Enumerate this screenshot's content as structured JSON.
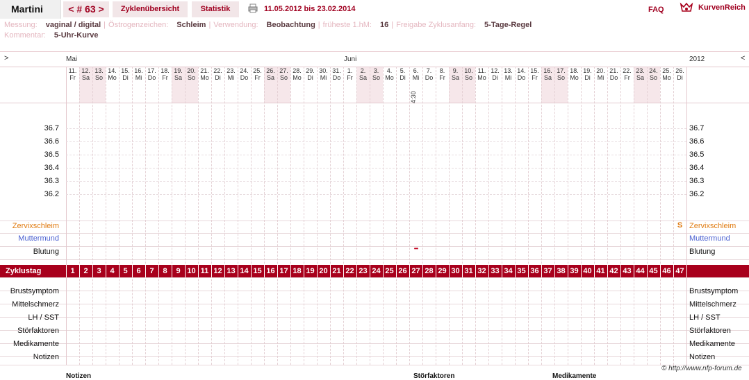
{
  "header": {
    "user": "Martini",
    "cycle": "< # 63 >",
    "tabs": [
      "Zyklenübersicht",
      "Statistik"
    ],
    "range": "11.05.2012 bis 23.02.2014",
    "faq": "FAQ",
    "brand": "KurvenReich"
  },
  "meta": {
    "row1": [
      {
        "label": "Messung:",
        "value": "vaginal / digital"
      },
      {
        "label": "Östrogenzeichen:",
        "value": "Schleim"
      },
      {
        "label": "Verwendung:",
        "value": "Beobachtung"
      },
      {
        "label": "früheste 1.hM:",
        "value": "16"
      },
      {
        "label": "Freigabe Zyklusanfang:",
        "value": "5-Tage-Regel"
      }
    ],
    "row2": [
      {
        "label": "Kommentar:",
        "value": "5-Uhr-Kurve"
      }
    ]
  },
  "chart": {
    "nav_left": ">",
    "nav_right": "<",
    "month1": "Mai",
    "month2": "Juni",
    "year": "2012",
    "days": [
      {
        "d": "11.",
        "w": "Fr",
        "we": false
      },
      {
        "d": "12.",
        "w": "Sa",
        "we": true
      },
      {
        "d": "13.",
        "w": "So",
        "we": true
      },
      {
        "d": "14.",
        "w": "Mo",
        "we": false
      },
      {
        "d": "15.",
        "w": "Di",
        "we": false
      },
      {
        "d": "16.",
        "w": "Mi",
        "we": false
      },
      {
        "d": "17.",
        "w": "Do",
        "we": false
      },
      {
        "d": "18.",
        "w": "Fr",
        "we": false
      },
      {
        "d": "19.",
        "w": "Sa",
        "we": true
      },
      {
        "d": "20.",
        "w": "So",
        "we": true
      },
      {
        "d": "21.",
        "w": "Mo",
        "we": false
      },
      {
        "d": "22.",
        "w": "Di",
        "we": false
      },
      {
        "d": "23.",
        "w": "Mi",
        "we": false
      },
      {
        "d": "24.",
        "w": "Do",
        "we": false
      },
      {
        "d": "25.",
        "w": "Fr",
        "we": false
      },
      {
        "d": "26.",
        "w": "Sa",
        "we": true
      },
      {
        "d": "27.",
        "w": "So",
        "we": true
      },
      {
        "d": "28.",
        "w": "Mo",
        "we": false
      },
      {
        "d": "29.",
        "w": "Di",
        "we": false
      },
      {
        "d": "30.",
        "w": "Mi",
        "we": false
      },
      {
        "d": "31.",
        "w": "Do",
        "we": false
      },
      {
        "d": "1.",
        "w": "Fr",
        "we": false
      },
      {
        "d": "2.",
        "w": "Sa",
        "we": true
      },
      {
        "d": "3.",
        "w": "So",
        "we": true
      },
      {
        "d": "4.",
        "w": "Mo",
        "we": false
      },
      {
        "d": "5.",
        "w": "Di",
        "we": false
      },
      {
        "d": "6.",
        "w": "Mi",
        "we": false
      },
      {
        "d": "7.",
        "w": "Do",
        "we": false
      },
      {
        "d": "8.",
        "w": "Fr",
        "we": false
      },
      {
        "d": "9.",
        "w": "Sa",
        "we": true
      },
      {
        "d": "10.",
        "w": "So",
        "we": true
      },
      {
        "d": "11.",
        "w": "Mo",
        "we": false
      },
      {
        "d": "12.",
        "w": "Di",
        "we": false
      },
      {
        "d": "13.",
        "w": "Mi",
        "we": false
      },
      {
        "d": "14.",
        "w": "Do",
        "we": false
      },
      {
        "d": "15.",
        "w": "Fr",
        "we": false
      },
      {
        "d": "16.",
        "w": "Sa",
        "we": true
      },
      {
        "d": "17.",
        "w": "So",
        "we": true
      },
      {
        "d": "18.",
        "w": "Mo",
        "we": false
      },
      {
        "d": "19.",
        "w": "Di",
        "we": false
      },
      {
        "d": "20.",
        "w": "Mi",
        "we": false
      },
      {
        "d": "21.",
        "w": "Do",
        "we": false
      },
      {
        "d": "22.",
        "w": "Fr",
        "we": false
      },
      {
        "d": "23.",
        "w": "Sa",
        "we": true
      },
      {
        "d": "24.",
        "w": "So",
        "we": true
      },
      {
        "d": "25.",
        "w": "Mo",
        "we": false
      },
      {
        "d": "26.",
        "w": "Di",
        "we": false
      }
    ],
    "time_note": {
      "day_index": 26,
      "text": "4:30"
    },
    "temps": [
      "36.7",
      "36.6",
      "36.5",
      "36.4",
      "36.3",
      "36.2"
    ],
    "rows_top": [
      {
        "label": "Zervixschleim",
        "color": "#e07a10"
      },
      {
        "label": "Muttermund",
        "color": "#4a5fd0"
      },
      {
        "label": "Blutung",
        "color": "#111111"
      }
    ],
    "cervix_mark": {
      "day_index": 46,
      "text": "S"
    },
    "bleeding_mark": {
      "day_index": 26,
      "text": "•••"
    },
    "cycle_label": "Zyklustag",
    "cycle_days": [
      "1",
      "2",
      "3",
      "4",
      "5",
      "6",
      "7",
      "8",
      "9",
      "10",
      "11",
      "12",
      "13",
      "14",
      "15",
      "16",
      "17",
      "18",
      "19",
      "20",
      "21",
      "22",
      "23",
      "24",
      "25",
      "26",
      "27",
      "28",
      "29",
      "30",
      "31",
      "32",
      "33",
      "34",
      "35",
      "36",
      "37",
      "38",
      "39",
      "40",
      "41",
      "42",
      "43",
      "44",
      "45",
      "46",
      "47"
    ],
    "rows_bottom": [
      "Brustsymptom",
      "Mittelschmerz",
      "LH / SST",
      "Störfaktoren",
      "Medikamente",
      "Notizen"
    ],
    "colors": {
      "accent": "#a8001c",
      "weekend": "#f6e7ea",
      "grid": "#e8d8db"
    }
  },
  "footer": {
    "copyright": "© http://www.nfp-forum.de",
    "cut_labels": [
      "Notizen",
      "Störfaktoren",
      "Medikamente"
    ]
  }
}
